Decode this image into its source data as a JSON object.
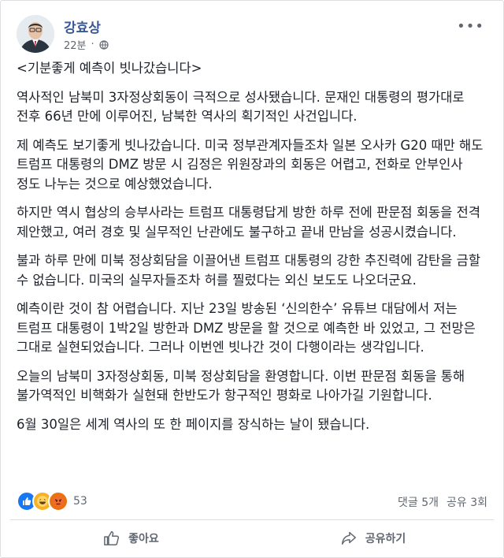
{
  "post": {
    "author": "강효상",
    "time": "22분",
    "privacy_icon": "globe-icon",
    "more_icon": "more-options-icon",
    "paragraphs": [
      "<기분좋게 예측이 빗나갔습니다>",
      "역사적인 남북미 3자정상회동이 극적으로 성사됐습니다. 문재인 대통령의 평가대로 전후 66년 만에 이루어진, 남북한 역사의 획기적인 사건입니다.",
      "제 예측도 보기좋게 빗나갔습니다. 미국 정부관계자들조차 일본 오사카 G20 때만 해도 트럼프 대통령의 DMZ 방문 시 김정은 위원장과의 회동은 어렵고, 전화로 안부인사 정도 나누는 것으로 예상했었습니다.",
      "하지만 역시 협상의 승부사라는 트럼프 대통령답게 방한 하루 전에 판문점 회동을 전격 제안했고, 여러 경호 및 실무적인 난관에도 불구하고 끝내 만남을 성공시켰습니다.",
      "불과 하루 만에 미북 정상회담을 이끌어낸 트럼프 대통령의 강한 추진력에 감탄을 금할 수 없습니다. 미국의 실무자들조차 허를 찔렀다는 외신 보도도 나오더군요.",
      "예측이란 것이 참 어렵습니다. 지난 23일 방송된 ‘신의한수’ 유튜브 대담에서 저는 트럼프 대통령이 1박2일 방한과 DMZ 방문을 할 것으로 예측한 바 있었고, 그 전망은 그대로 실현되었습니다. 그러나 이번엔 빗나간 것이 다행이라는 생각입니다.",
      "오늘의 남북미 3자정상회동, 미북 정상회담을 환영합니다. 이번 판문점 회동을 통해 불가역적인 비핵화가 실현돼 한반도가 항구적인 평화로 나아가길 기원합니다.",
      "6월 30일은 세계 역사의 또 한 페이지를 장식하는 날이 됐습니다."
    ]
  },
  "reactions": {
    "icons": [
      "like-reaction-icon",
      "haha-reaction-icon",
      "angry-reaction-icon"
    ],
    "count": "53"
  },
  "counts": {
    "comments": "댓글 5개",
    "shares": "공유 3회"
  },
  "actions": {
    "like": "좋아요",
    "share": "공유하기"
  },
  "colors": {
    "author_link": "#385898",
    "meta": "#606770",
    "like_blue": "#1877f2"
  }
}
